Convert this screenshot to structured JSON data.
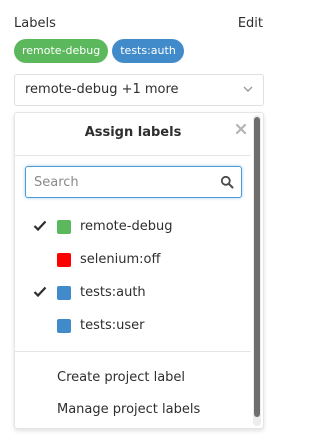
{
  "header": {
    "title": "Labels",
    "edit_label": "Edit"
  },
  "selected_labels": [
    {
      "name": "remote-debug",
      "color": "#5cb85c"
    },
    {
      "name": "tests:auth",
      "color": "#428bca"
    }
  ],
  "dropdown": {
    "value": "remote-debug +1 more",
    "caret_icon": "chevron-down-icon"
  },
  "menu": {
    "title": "Assign labels",
    "close_icon": "close-icon",
    "search": {
      "placeholder": "Search",
      "value": "",
      "icon": "search-icon"
    },
    "labels": [
      {
        "name": "remote-debug",
        "color": "#5cb85c",
        "checked": true
      },
      {
        "name": "selenium:off",
        "color": "#ff0000",
        "checked": false
      },
      {
        "name": "tests:auth",
        "color": "#428bca",
        "checked": true
      },
      {
        "name": "tests:user",
        "color": "#428bca",
        "checked": false
      }
    ],
    "footer": {
      "create_label": "Create project label",
      "manage_label": "Manage project labels"
    }
  }
}
